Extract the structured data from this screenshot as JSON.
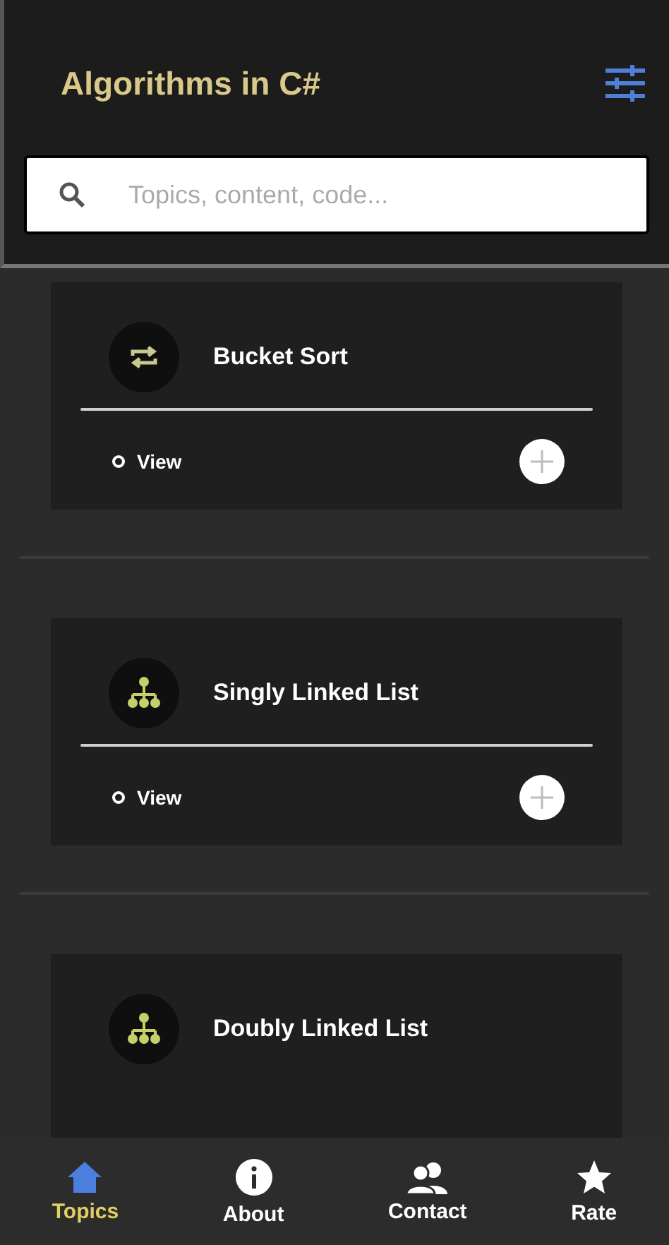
{
  "header": {
    "title": "Algorithms in C#"
  },
  "search": {
    "placeholder": "Topics, content, code..."
  },
  "topics": [
    {
      "title": "Bucket Sort",
      "kind": "sort",
      "action": "View"
    },
    {
      "title": "Singly Linked List",
      "kind": "tree",
      "action": "View"
    },
    {
      "title": "Doubly Linked List",
      "kind": "tree"
    }
  ],
  "nav": [
    {
      "label": "Topics",
      "kind": "home",
      "selected": true
    },
    {
      "label": "About",
      "kind": "info",
      "selected": false
    },
    {
      "label": "Contact",
      "kind": "people",
      "selected": false
    },
    {
      "label": "Rate",
      "kind": "star",
      "selected": false
    }
  ]
}
